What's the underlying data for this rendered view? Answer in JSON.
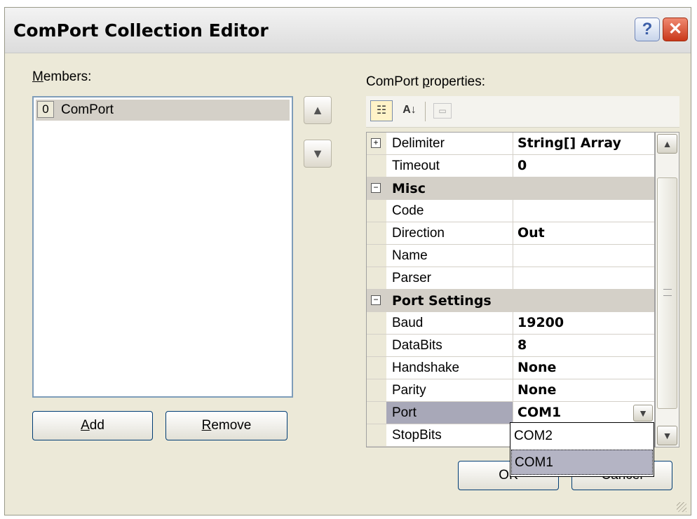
{
  "window": {
    "title": "ComPort Collection Editor",
    "help_label": "?",
    "close_label": "✕"
  },
  "members": {
    "label_underlined": "M",
    "label_rest": "embers:",
    "items": [
      {
        "index": "0",
        "name": "ComPort"
      }
    ],
    "move_up_icon": "arrow-up-icon",
    "move_down_icon": "arrow-down-icon",
    "add_underlined": "A",
    "add_rest": "dd",
    "remove_underlined": "R",
    "remove_rest": "emove"
  },
  "properties": {
    "label_before": "ComPort ",
    "label_underlined": "p",
    "label_after": "roperties:",
    "toolbar": {
      "categorized_icon": "categorized-icon",
      "alphabetical_icon": "sort-az-icon",
      "pages_icon": "property-pages-icon"
    },
    "rows": [
      {
        "type": "prop",
        "expander": "+",
        "name": "Delimiter",
        "value": "String[] Array"
      },
      {
        "type": "prop",
        "name": "Timeout",
        "value": "0"
      },
      {
        "type": "category",
        "expander": "−",
        "name": "Misc"
      },
      {
        "type": "prop",
        "name": "Code",
        "value": ""
      },
      {
        "type": "prop",
        "name": "Direction",
        "value": "Out"
      },
      {
        "type": "prop",
        "name": "Name",
        "value": ""
      },
      {
        "type": "prop",
        "name": "Parser",
        "value": ""
      },
      {
        "type": "category",
        "expander": "−",
        "name": "Port Settings"
      },
      {
        "type": "prop",
        "name": "Baud",
        "value": "19200"
      },
      {
        "type": "prop",
        "name": "DataBits",
        "value": "8"
      },
      {
        "type": "prop",
        "name": "Handshake",
        "value": "None"
      },
      {
        "type": "prop",
        "name": "Parity",
        "value": "None"
      },
      {
        "type": "prop",
        "name": "Port",
        "value": "COM1",
        "selected": true
      },
      {
        "type": "prop",
        "name": "StopBits",
        "value": ""
      }
    ],
    "port_dropdown": {
      "options": [
        "COM2",
        "COM1"
      ],
      "highlighted": "COM1"
    }
  },
  "buttons": {
    "ok": "OK",
    "cancel": "Cancel"
  }
}
